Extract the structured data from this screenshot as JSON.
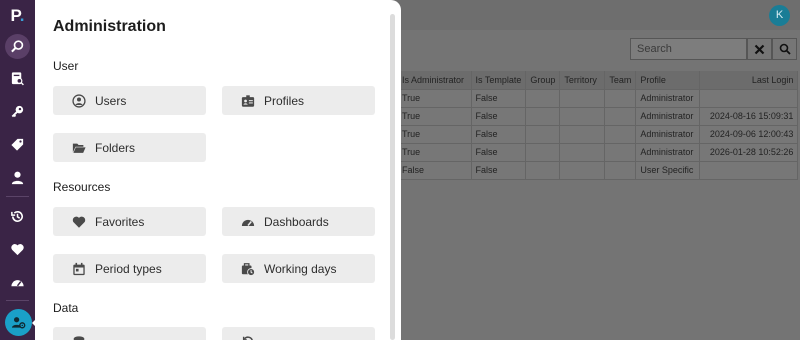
{
  "app": {
    "logo_letter": "P",
    "logo_dot": "."
  },
  "user": {
    "avatar_initial": "K"
  },
  "colors": {
    "rail": "#3a2446",
    "accent": "#1aa0c8",
    "panel": "#ffffff",
    "tile": "#ececec"
  },
  "rail": {
    "icons": [
      "search-icon",
      "report-search-icon",
      "key-icon",
      "tags-icon",
      "user-icon",
      "history-icon",
      "heart-icon",
      "dashboard-icon"
    ],
    "active": "administration-icon"
  },
  "search": {
    "placeholder": "Search"
  },
  "table": {
    "headers": [
      "Is Administrator",
      "Is Template",
      "Group",
      "Territory",
      "Team",
      "Profile",
      "Last Login"
    ],
    "rows": [
      [
        "True",
        "False",
        "",
        "",
        "",
        "Administrator",
        ""
      ],
      [
        "True",
        "False",
        "",
        "",
        "",
        "Administrator",
        "2024-08-16 15:09:31"
      ],
      [
        "True",
        "False",
        "",
        "",
        "",
        "Administrator",
        "2024-09-06 12:00:43"
      ],
      [
        "True",
        "False",
        "",
        "",
        "",
        "Administrator",
        "2026-01-28 10:52:26"
      ],
      [
        "False",
        "False",
        "",
        "",
        "",
        "User Specific",
        ""
      ]
    ]
  },
  "admin": {
    "title": "Administration",
    "sections": [
      {
        "label": "User",
        "items": [
          {
            "label": "Users",
            "icon": "user-circle-icon"
          },
          {
            "label": "Profiles",
            "icon": "id-card-icon"
          },
          {
            "label": "Folders",
            "icon": "folder-open-icon"
          }
        ]
      },
      {
        "label": "Resources",
        "items": [
          {
            "label": "Favorites",
            "icon": "heart-icon"
          },
          {
            "label": "Dashboards",
            "icon": "gauge-icon"
          },
          {
            "label": "Period types",
            "icon": "calendar-icon"
          },
          {
            "label": "Working days",
            "icon": "briefcase-clock-icon"
          }
        ]
      },
      {
        "label": "Data",
        "items": [
          {
            "label": "",
            "icon": "database-icon"
          },
          {
            "label": "",
            "icon": "sync-icon"
          }
        ]
      }
    ]
  }
}
